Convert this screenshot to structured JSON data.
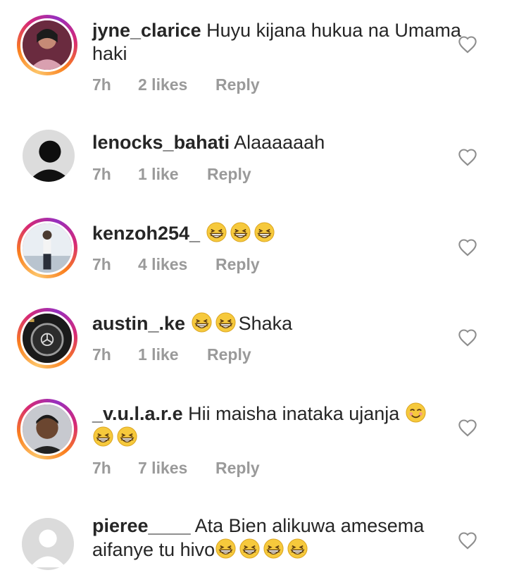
{
  "comments": [
    {
      "username": "jyne_clarice",
      "text": "Huyu kijana hukua na Umama haki",
      "time": "7h",
      "likes": "2 likes",
      "reply": "Reply",
      "avatar": "person-portrait",
      "story_ring": true,
      "emojis": []
    },
    {
      "username": "lenocks_bahati",
      "text": "Alaaaaaah",
      "time": "7h",
      "likes": "1 like",
      "reply": "Reply",
      "avatar": "silhouette-portrait",
      "story_ring": false,
      "emojis": []
    },
    {
      "username": "kenzoh254_",
      "text": "",
      "time": "7h",
      "likes": "4 likes",
      "reply": "Reply",
      "avatar": "person-standing",
      "story_ring": true,
      "emojis": [
        "grinning-squinting-face",
        "grinning-squinting-face",
        "grinning-squinting-face"
      ]
    },
    {
      "username": "austin_.ke",
      "text": "Shaka",
      "time": "7h",
      "likes": "1 like",
      "reply": "Reply",
      "avatar": "steering-wheel",
      "story_ring": true,
      "emojis": [
        "grinning-squinting-face",
        "grinning-squinting-face"
      ]
    },
    {
      "username": "_v.u.l.a.r.e",
      "text": "Hii maisha inataka ujanja",
      "time": "7h",
      "likes": "7 likes",
      "reply": "Reply",
      "avatar": "person-portrait",
      "story_ring": true,
      "emojis": [
        "smiling-face",
        "grinning-squinting-face",
        "grinning-squinting-face"
      ]
    },
    {
      "username": "pieree____",
      "text": "Ata Bien alikuwa amesema aifanye tu hivo",
      "time": "",
      "likes": "",
      "reply": "",
      "avatar": "default-avatar",
      "story_ring": false,
      "emojis": [
        "grinning-squinting-face",
        "grinning-squinting-face",
        "grinning-squinting-face",
        "grinning-squinting-face"
      ]
    }
  ],
  "colors": {
    "ring_gradient": [
      "#fdc468",
      "#fa7e1e",
      "#d62976",
      "#962fbf"
    ],
    "meta_text": "#9a9a9a",
    "text": "#262626"
  },
  "icons": {
    "like": "heart-outline-icon"
  }
}
